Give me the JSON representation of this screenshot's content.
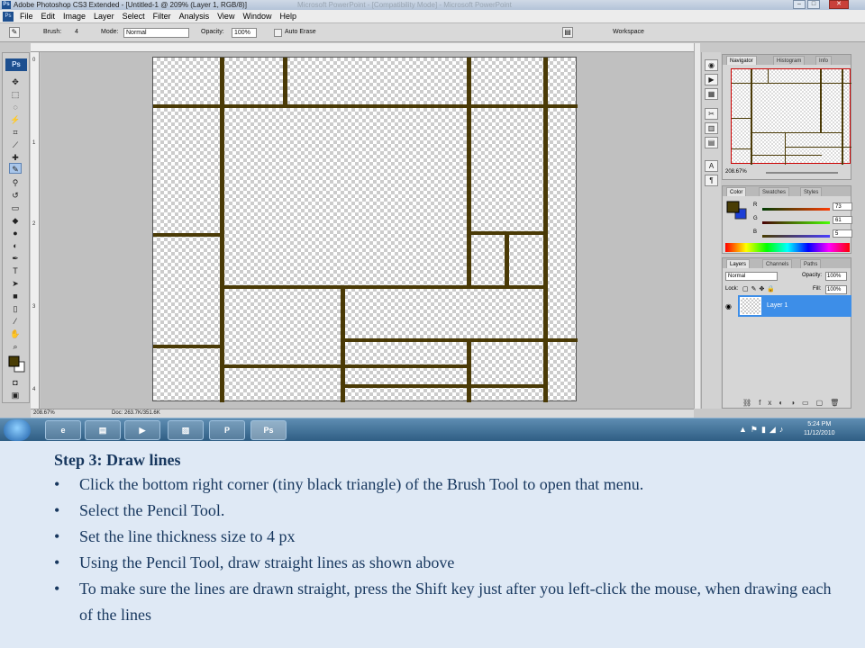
{
  "window": {
    "title": "Adobe Photoshop CS3 Extended - [Untitled-1 @ 209% (Layer 1, RGB/8)]",
    "title_faded": "Microsoft PowerPoint - [Compatibility Mode] - Microsoft PowerPoint"
  },
  "menu": [
    "File",
    "Edit",
    "Image",
    "Layer",
    "Select",
    "Filter",
    "Analysis",
    "View",
    "Window",
    "Help"
  ],
  "options": {
    "brush_label": "Brush:",
    "brush_size": "4",
    "mode_label": "Mode:",
    "mode_value": "Normal",
    "opacity_label": "Opacity:",
    "opacity_value": "100%",
    "auto_erase_label": "Auto Erase",
    "workspace_label": "Workspace"
  },
  "toolbox": {
    "badge": "Ps"
  },
  "ruler_left_marks": [
    "0",
    "1",
    "2",
    "3",
    "4"
  ],
  "status": {
    "zoom": "208.67%",
    "doc": "Doc: 263.7K/351.6K"
  },
  "navigator": {
    "tabs": [
      "Navigator",
      "Histogram",
      "Info"
    ],
    "zoom": "208.67%"
  },
  "color_panel": {
    "tabs": [
      "Color",
      "Swatches",
      "Styles"
    ],
    "channels": [
      {
        "name": "R",
        "value": "73"
      },
      {
        "name": "G",
        "value": "61"
      },
      {
        "name": "B",
        "value": "5"
      }
    ],
    "foreground": "#493d05"
  },
  "layers_panel": {
    "tabs": [
      "Layers",
      "Channels",
      "Paths"
    ],
    "blend_mode": "Normal",
    "opacity_label": "Opacity:",
    "opacity_value": "100%",
    "lock_label": "Lock:",
    "fill_label": "Fill:",
    "fill_value": "100%",
    "layer_name": "Layer 1"
  },
  "taskbar": {
    "ps_label": "Ps",
    "time": "5:24 PM",
    "date": "11/12/2010"
  },
  "instructions": {
    "title": "Step 3: Draw lines",
    "bullets": [
      "Click the bottom right corner (tiny black triangle) of the Brush Tool to open that menu.",
      "Select the Pencil Tool.",
      "Set the line thickness size to 4 px",
      "Using the Pencil Tool, draw straight lines as shown above",
      "To make sure the lines are drawn straight, press the Shift key just after you left-click the mouse, when drawing each of the lines"
    ]
  }
}
